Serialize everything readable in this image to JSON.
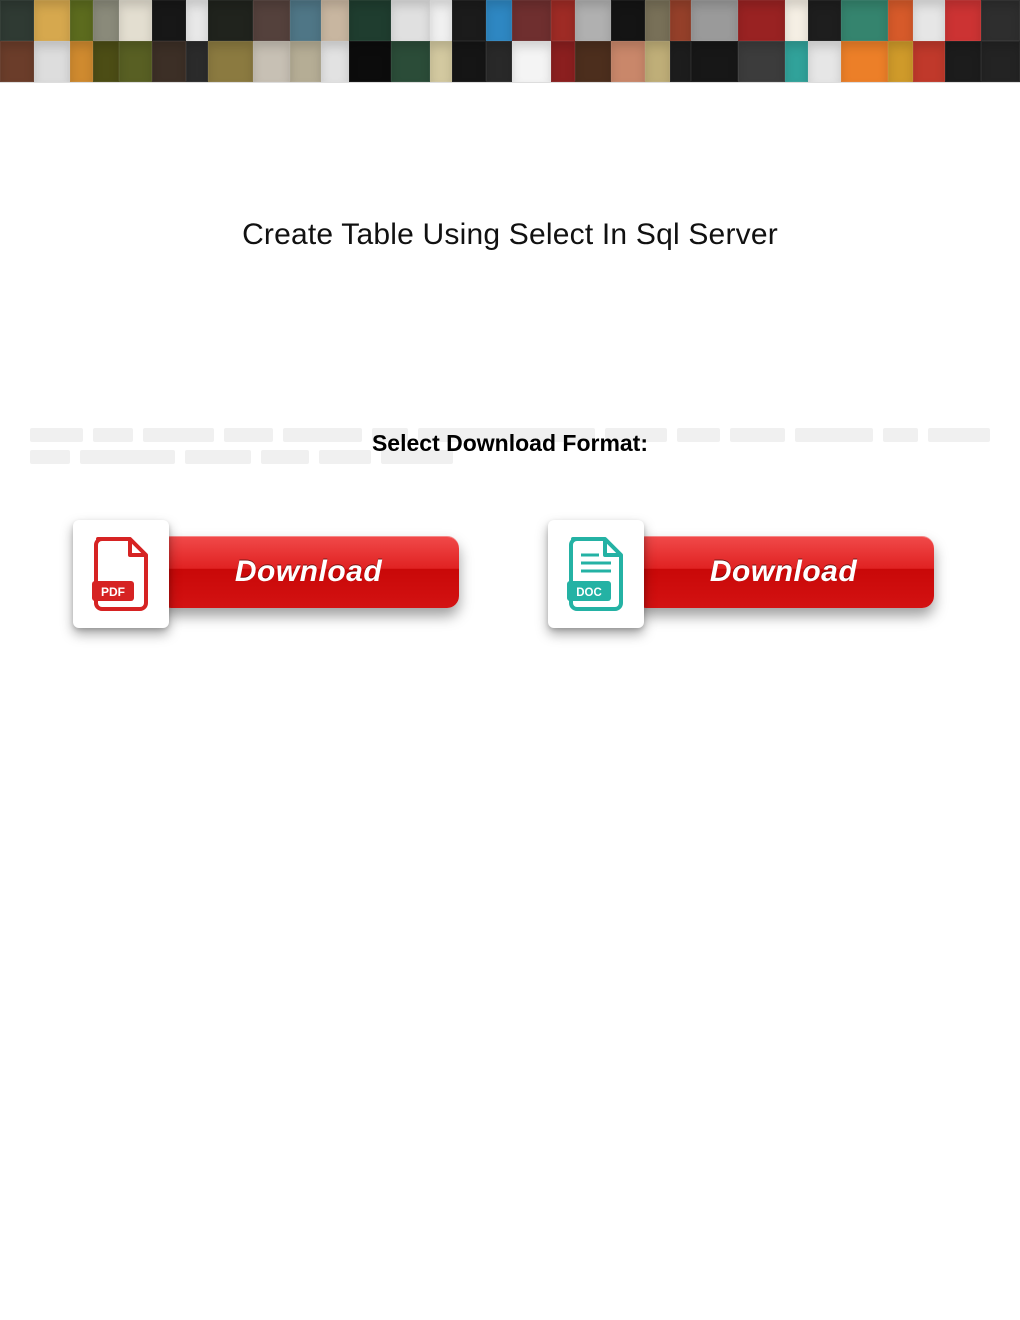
{
  "title": "Create Table Using Select In Sql Server",
  "subheader": "Select Download Format:",
  "downloads": {
    "pdf": {
      "label": "Download",
      "badge": "PDF"
    },
    "doc": {
      "label": "Download",
      "badge": "DOC"
    }
  },
  "banner": {
    "row1_colors": [
      "#2f3a33",
      "#d6a84e",
      "#5c6b1e",
      "#8a8a7a",
      "#e3ded0",
      "#171717",
      "#e8e8e8",
      "#20231d",
      "#54413c",
      "#4f7686",
      "#c8b6a0",
      "#1f3d2f",
      "#e0e0e0",
      "#f0f0f0",
      "#1b1b1b",
      "#2e87c2",
      "#6f2f2f",
      "#9e2b25",
      "#b0b0b0",
      "#141414",
      "#787058",
      "#95402a",
      "#9a9a9a",
      "#992222",
      "#f5efe4",
      "#1e1e1e",
      "#35846e",
      "#d65a2a",
      "#e6e6e6",
      "#c33",
      "#2e2e2e"
    ],
    "row2_colors": [
      "#6b3d2a",
      "#dddddd",
      "#cf8a2f",
      "#4c4d15",
      "#585f23",
      "#3c2f26",
      "#2b2b2b",
      "#8b7a40",
      "#c7c0b4",
      "#b5ad95",
      "#e2e2e2",
      "#0c0c0c",
      "#2b4c38",
      "#d3c9a0",
      "#151515",
      "#292929",
      "#f4f4f4",
      "#8b1f1f",
      "#4c2e1d",
      "#c9876a",
      "#bfae78",
      "#1d1d1d",
      "#171717",
      "#3c3c3c",
      "#31a29a",
      "#e6e6e6",
      "#ec7f28",
      "#cf9a2a",
      "#c0392b",
      "#1c1c1c",
      "#232323"
    ]
  },
  "ghost_lines": [
    [
      60,
      45,
      80,
      55,
      90,
      40,
      200,
      70,
      48,
      62,
      88,
      40,
      70
    ],
    [
      40,
      95,
      66,
      48,
      52,
      72
    ]
  ]
}
